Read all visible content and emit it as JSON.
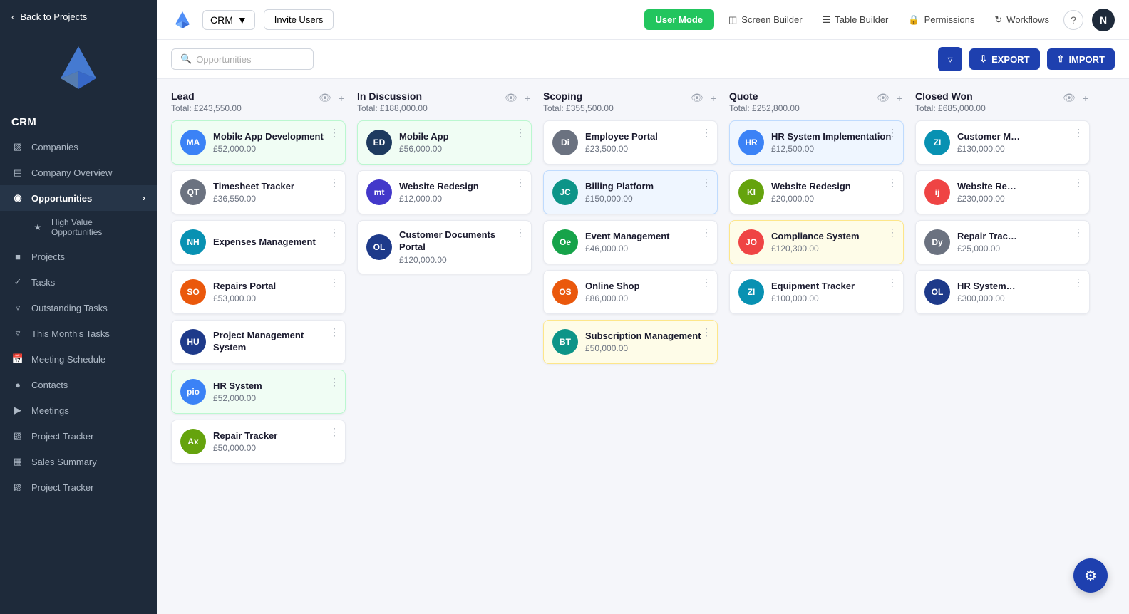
{
  "sidebar": {
    "back_label": "Back to Projects",
    "crm_label": "CRM",
    "items": [
      {
        "id": "companies",
        "label": "Companies",
        "icon": "building"
      },
      {
        "id": "company-overview",
        "label": "Company Overview",
        "icon": "chart"
      },
      {
        "id": "opportunities",
        "label": "Opportunities",
        "icon": "target",
        "active": true,
        "has_arrow": true
      },
      {
        "id": "high-value",
        "label": "High Value Opportunities",
        "icon": "star",
        "indented": true
      },
      {
        "id": "projects",
        "label": "Projects",
        "icon": "folder"
      },
      {
        "id": "tasks",
        "label": "Tasks",
        "icon": "check"
      },
      {
        "id": "outstanding-tasks",
        "label": "Outstanding Tasks",
        "icon": "filter"
      },
      {
        "id": "this-months-tasks",
        "label": "This Month's Tasks",
        "icon": "filter"
      },
      {
        "id": "meeting-schedule",
        "label": "Meeting Schedule",
        "icon": "calendar"
      },
      {
        "id": "contacts",
        "label": "Contacts",
        "icon": "person"
      },
      {
        "id": "meetings",
        "label": "Meetings",
        "icon": "video"
      },
      {
        "id": "project-tracker",
        "label": "Project Tracker",
        "icon": "grid"
      },
      {
        "id": "sales-summary",
        "label": "Sales Summary",
        "icon": "chart2"
      },
      {
        "id": "project-tracker2",
        "label": "Project Tracker",
        "icon": "grid2"
      }
    ]
  },
  "topbar": {
    "crm": "CRM",
    "invite_users": "Invite Users",
    "user_mode": "User Mode",
    "screen_builder": "Screen Builder",
    "table_builder": "Table Builder",
    "permissions": "Permissions",
    "workflows": "Workflows",
    "avatar": "N"
  },
  "toolbar": {
    "search_placeholder": "Opportunities",
    "export": "EXPORT",
    "import": "IMPORT"
  },
  "board": {
    "columns": [
      {
        "id": "lead",
        "title": "Lead",
        "total": "Total: £243,550.00",
        "cards": [
          {
            "id": "c1",
            "name": "Mobile App Development",
            "price": "£52,000.00",
            "initials": "MA",
            "color": "av-blue",
            "highlight": "highlight-green"
          },
          {
            "id": "c2",
            "name": "Timesheet Tracker",
            "price": "£36,550.00",
            "initials": "QT",
            "color": "av-gray",
            "highlight": ""
          },
          {
            "id": "c3",
            "name": "Expenses Management",
            "price": "",
            "initials": "NH",
            "color": "av-cyan",
            "highlight": ""
          },
          {
            "id": "c4",
            "name": "Repairs Portal",
            "price": "£53,000.00",
            "initials": "SO",
            "color": "av-orange",
            "highlight": ""
          },
          {
            "id": "c5",
            "name": "Project Management System",
            "price": "",
            "initials": "HU",
            "color": "av-navy",
            "highlight": ""
          },
          {
            "id": "c6",
            "name": "HR System",
            "price": "£52,000.00",
            "initials": "pio",
            "color": "av-blue",
            "highlight": "highlight-green"
          },
          {
            "id": "c7",
            "name": "Repair Tracker",
            "price": "£50,000.00",
            "initials": "Ax",
            "color": "av-lime",
            "highlight": ""
          }
        ]
      },
      {
        "id": "in-discussion",
        "title": "In Discussion",
        "total": "Total: £188,000.00",
        "cards": [
          {
            "id": "d1",
            "name": "Mobile App",
            "price": "£56,000.00",
            "initials": "ED",
            "color": "av-dark",
            "highlight": "highlight-green"
          },
          {
            "id": "d2",
            "name": "Website Redesign",
            "price": "£12,000.00",
            "initials": "mt",
            "color": "av-indigo",
            "highlight": ""
          },
          {
            "id": "d3",
            "name": "Customer Documents Portal",
            "price": "£120,000.00",
            "initials": "OL",
            "color": "av-navy",
            "highlight": ""
          }
        ]
      },
      {
        "id": "scoping",
        "title": "Scoping",
        "total": "Total: £355,500.00",
        "cards": [
          {
            "id": "s1",
            "name": "Employee Portal",
            "price": "£23,500.00",
            "initials": "Di",
            "color": "av-gray",
            "highlight": ""
          },
          {
            "id": "s2",
            "name": "Billing Platform",
            "price": "£150,000.00",
            "initials": "JC",
            "color": "av-teal",
            "highlight": "highlight-blue"
          },
          {
            "id": "s3",
            "name": "Event Management",
            "price": "£46,000.00",
            "initials": "Oe",
            "color": "av-green",
            "highlight": ""
          },
          {
            "id": "s4",
            "name": "Online Shop",
            "price": "£86,000.00",
            "initials": "OS",
            "color": "av-orange",
            "highlight": ""
          },
          {
            "id": "s5",
            "name": "Subscription Management",
            "price": "£50,000.00",
            "initials": "BT",
            "color": "av-teal",
            "highlight": "highlight-yellow"
          }
        ]
      },
      {
        "id": "quote",
        "title": "Quote",
        "total": "Total: £252,800.00",
        "cards": [
          {
            "id": "q1",
            "name": "HR System Implementation",
            "price": "£12,500.00",
            "initials": "HR",
            "color": "av-blue",
            "highlight": "highlight-blue"
          },
          {
            "id": "q2",
            "name": "Website Redesign",
            "price": "£20,000.00",
            "initials": "KI",
            "color": "av-lime",
            "highlight": ""
          },
          {
            "id": "q3",
            "name": "Compliance System",
            "price": "£120,300.00",
            "initials": "JO",
            "color": "av-red",
            "highlight": "highlight-yellow"
          },
          {
            "id": "q4",
            "name": "Equipment Tracker",
            "price": "£100,000.00",
            "initials": "ZI",
            "color": "av-cyan",
            "highlight": ""
          }
        ]
      },
      {
        "id": "closed-won",
        "title": "Closed Won",
        "total": "Total: £685,000.00",
        "cards": [
          {
            "id": "w1",
            "name": "Customer M…",
            "price": "£130,000.00",
            "initials": "ZI",
            "color": "av-cyan",
            "highlight": ""
          },
          {
            "id": "w2",
            "name": "Website Re…",
            "price": "£230,000.00",
            "initials": "ij",
            "color": "av-red",
            "highlight": ""
          },
          {
            "id": "w3",
            "name": "Repair Trac…",
            "price": "£25,000.00",
            "initials": "Dy",
            "color": "av-gray",
            "highlight": ""
          },
          {
            "id": "w4",
            "name": "HR System…",
            "price": "£300,000.00",
            "initials": "OL",
            "color": "av-navy",
            "highlight": ""
          }
        ]
      }
    ]
  }
}
